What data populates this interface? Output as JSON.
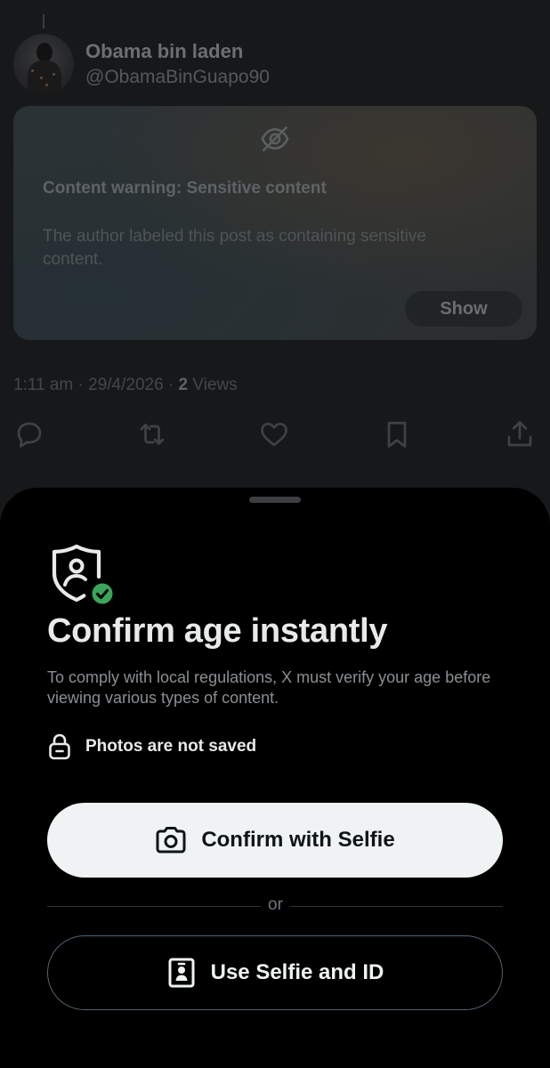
{
  "post": {
    "display_name": "Obama bin laden",
    "handle": "@ObamaBinGuapo90",
    "content_warning_title": "Content warning: Sensitive content",
    "content_warning_body": "The author labeled this post as containing sensitive content.",
    "show_label": "Show",
    "time": "1:11 am · 29/4/2026 · ",
    "views_count": "2",
    "views_label": " Views",
    "actions": {
      "reply_icon": "reply-icon",
      "repost_icon": "repost-icon",
      "like_icon": "heart-icon",
      "bookmark_icon": "bookmark-icon",
      "share_icon": "share-icon"
    }
  },
  "sheet": {
    "icon": "shield-person-check-icon",
    "title": "Confirm age instantly",
    "description": "To comply with local regulations, X must verify your age before viewing various types of content.",
    "privacy_note": "Photos are not saved",
    "primary_button": "Confirm with Selfie",
    "separator": "or",
    "secondary_button": "Use Selfie and ID"
  },
  "colors": {
    "sheet_background": "#000000",
    "primary_button_bg": "#eff3f4",
    "check_badge": "#3ba55c",
    "text_primary": "#e7e9ea",
    "text_secondary": "#8b8f93"
  }
}
